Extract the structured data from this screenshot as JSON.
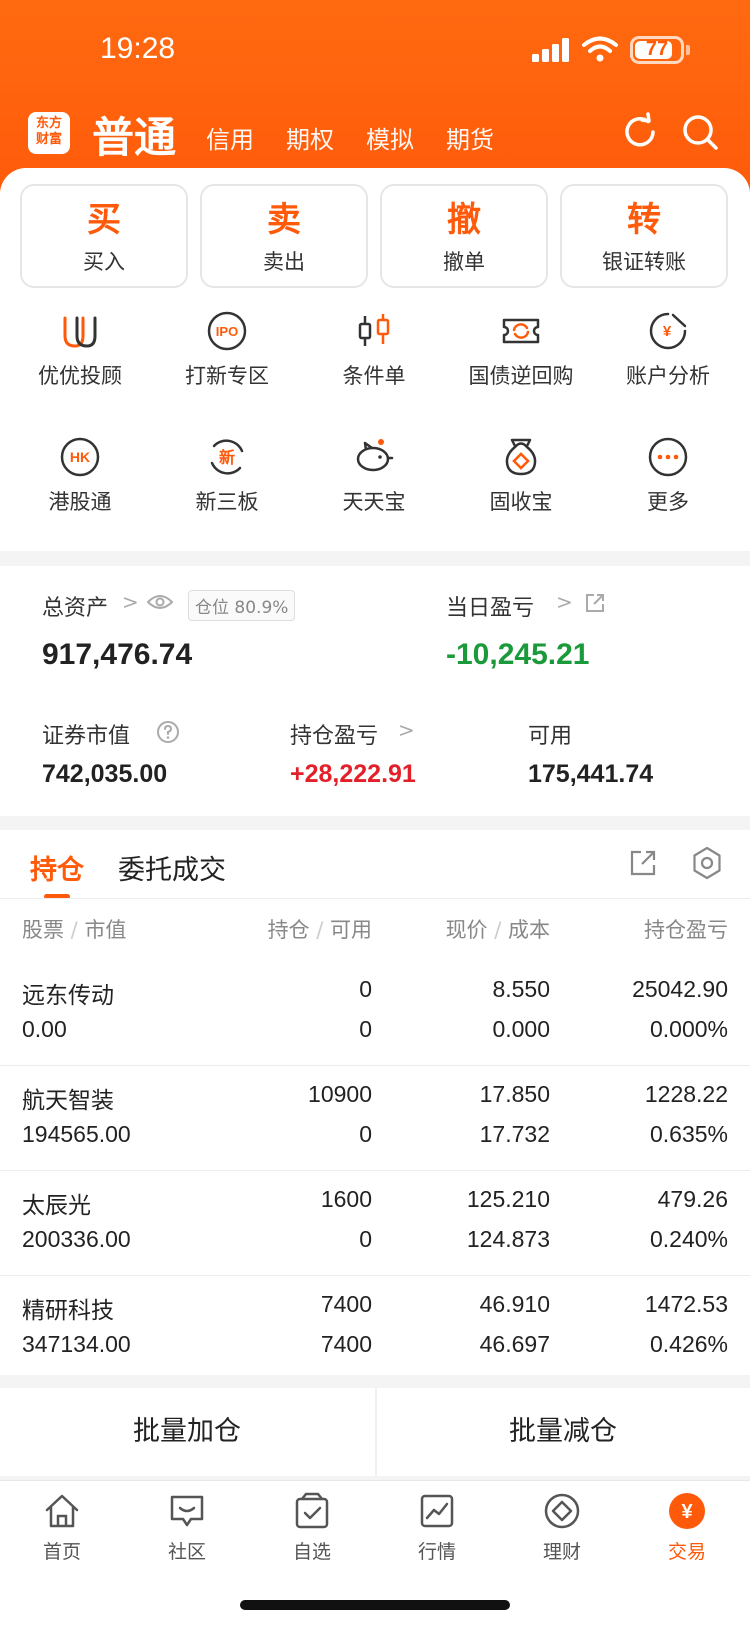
{
  "status": {
    "time": "19:28",
    "battery": "77"
  },
  "header": {
    "logo_line1": "东方",
    "logo_line2": "财富",
    "active_tab": "普通",
    "tabs": [
      "信用",
      "期权",
      "模拟",
      "期货"
    ]
  },
  "actions": [
    {
      "big": "买",
      "small": "买入"
    },
    {
      "big": "卖",
      "small": "卖出"
    },
    {
      "big": "撤",
      "small": "撤单"
    },
    {
      "big": "转",
      "small": "银证转账"
    }
  ],
  "grid": [
    {
      "label": "优优投顾",
      "icon": "uu-icon"
    },
    {
      "label": "打新专区",
      "icon": "ipo-icon"
    },
    {
      "label": "条件单",
      "icon": "candlestick-icon"
    },
    {
      "label": "国债逆回购",
      "icon": "bond-repo-icon"
    },
    {
      "label": "账户分析",
      "icon": "account-analysis-icon"
    },
    {
      "label": "港股通",
      "icon": "hk-icon"
    },
    {
      "label": "新三板",
      "icon": "new-board-icon"
    },
    {
      "label": "天天宝",
      "icon": "piggy-bank-icon"
    },
    {
      "label": "固收宝",
      "icon": "money-bag-icon"
    },
    {
      "label": "更多",
      "icon": "more-icon"
    }
  ],
  "grid_icon_text": {
    "ipo": "IPO",
    "hk": "HK",
    "new": "新",
    "yen": "¥"
  },
  "assets": {
    "total_label": "总资产",
    "position_badge": "仓位 80.9%",
    "total_value": "917,476.74",
    "daily_pl_label": "当日盈亏",
    "daily_pl_value": "-10,245.21",
    "market_value_label": "证券市值",
    "market_value": "742,035.00",
    "holding_pl_label": "持仓盈亏",
    "holding_pl_value": "+28,222.91",
    "available_label": "可用",
    "available_value": "175,441.74"
  },
  "positions": {
    "tab_holding": "持仓",
    "tab_orders": "委托成交",
    "columns": {
      "c1a": "股票",
      "c1b": "市值",
      "c2a": "持仓",
      "c2b": "可用",
      "c3a": "现价",
      "c3b": "成本",
      "c4": "持仓盈亏"
    },
    "rows": [
      {
        "name": "远东传动",
        "mv": "0.00",
        "hold": "0",
        "avail": "0",
        "price": "8.550",
        "cost": "0.000",
        "pl": "25042.90",
        "pct": "0.000%"
      },
      {
        "name": "航天智装",
        "mv": "194565.00",
        "hold": "10900",
        "avail": "0",
        "price": "17.850",
        "cost": "17.732",
        "pl": "1228.22",
        "pct": "0.635%"
      },
      {
        "name": "太辰光",
        "mv": "200336.00",
        "hold": "1600",
        "avail": "0",
        "price": "125.210",
        "cost": "124.873",
        "pl": "479.26",
        "pct": "0.240%"
      },
      {
        "name": "精研科技",
        "mv": "347134.00",
        "hold": "7400",
        "avail": "7400",
        "price": "46.910",
        "cost": "46.697",
        "pl": "1472.53",
        "pct": "0.426%"
      }
    ]
  },
  "batch": {
    "add": "批量加仓",
    "reduce": "批量减仓"
  },
  "tabbar": [
    {
      "label": "首页",
      "icon": "home-icon"
    },
    {
      "label": "社区",
      "icon": "community-icon"
    },
    {
      "label": "自选",
      "icon": "watchlist-icon"
    },
    {
      "label": "行情",
      "icon": "market-icon"
    },
    {
      "label": "理财",
      "icon": "wealth-icon"
    },
    {
      "label": "交易",
      "icon": "trade-icon"
    }
  ],
  "trade_icon_glyph": "¥",
  "colors": {
    "brand": "#ff5a0a",
    "up": "#e3202a",
    "down": "#1a9a3a"
  }
}
